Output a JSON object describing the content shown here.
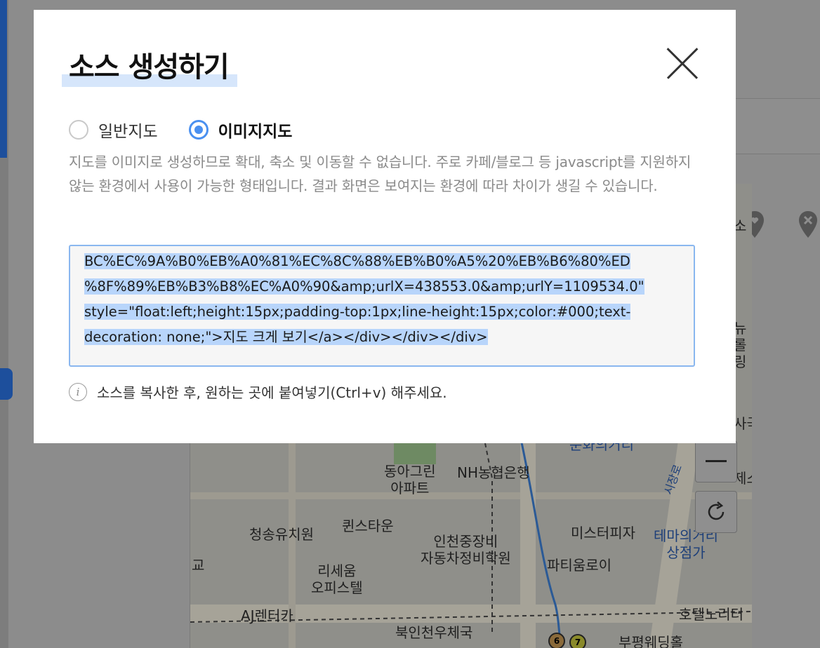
{
  "modal": {
    "title": "소스 생성하기",
    "close_icon": "close-x-icon",
    "radio_options": [
      {
        "label": "일반지도",
        "checked": false
      },
      {
        "label": "이미지지도",
        "checked": true
      }
    ],
    "description": "지도를 이미지로 생성하므로 확대, 축소 및 이동할 수 없습니다. 주로 카페/블로그 등 javascript를 지원하지 않는 환경에서 사용이 가능한 형태입니다. 결과 화면은 보여지는 환경에 따라 차이가 생길 수 있습니다.",
    "code_lines": [
      "BC%EC%9A%B0%EB%A0%81%EC%8C%88%EB%B0%A5%20%EB%B6%80%ED",
      "%8F%89%EB%B3%B8%EC%A0%90&amp;urlX=438553.0&amp;urlY=1109534.0\"",
      "style=\"float:left;height:15px;padding-top:1px;line-height:15px;color:#000;text-",
      "decoration: none;\">지도 크게 보기</a></div></div></div>"
    ],
    "hint": "소스를 복사한 후, 원하는 곳에 붙여넣기(Ctrl+v) 해주세요.",
    "accent_color": "#4a90f0"
  },
  "background_map": {
    "labels": [
      {
        "text": "동아그린\n아파트"
      },
      {
        "text": "NH농협은행"
      },
      {
        "text": "청송유치원"
      },
      {
        "text": "퀸스타운"
      },
      {
        "text": "인천중장비\n자동차정비학원"
      },
      {
        "text": "미스터피자"
      },
      {
        "text": "테마의거리\n상점가"
      },
      {
        "text": "파티움로이"
      },
      {
        "text": "리세움\n오피스텔"
      },
      {
        "text": "AJ렌터카"
      },
      {
        "text": "호텔노리터"
      },
      {
        "text": "북인천우체국"
      },
      {
        "text": "부평웨딩홀"
      },
      {
        "text": "문화의거리"
      },
      {
        "text": "시장로"
      },
      {
        "text": "소"
      },
      {
        "text": "뉴\n롤링"
      },
      {
        "text": "사국"
      },
      {
        "text": "제스"
      },
      {
        "text": "교"
      }
    ],
    "metro_badges": [
      "6",
      "7"
    ]
  }
}
